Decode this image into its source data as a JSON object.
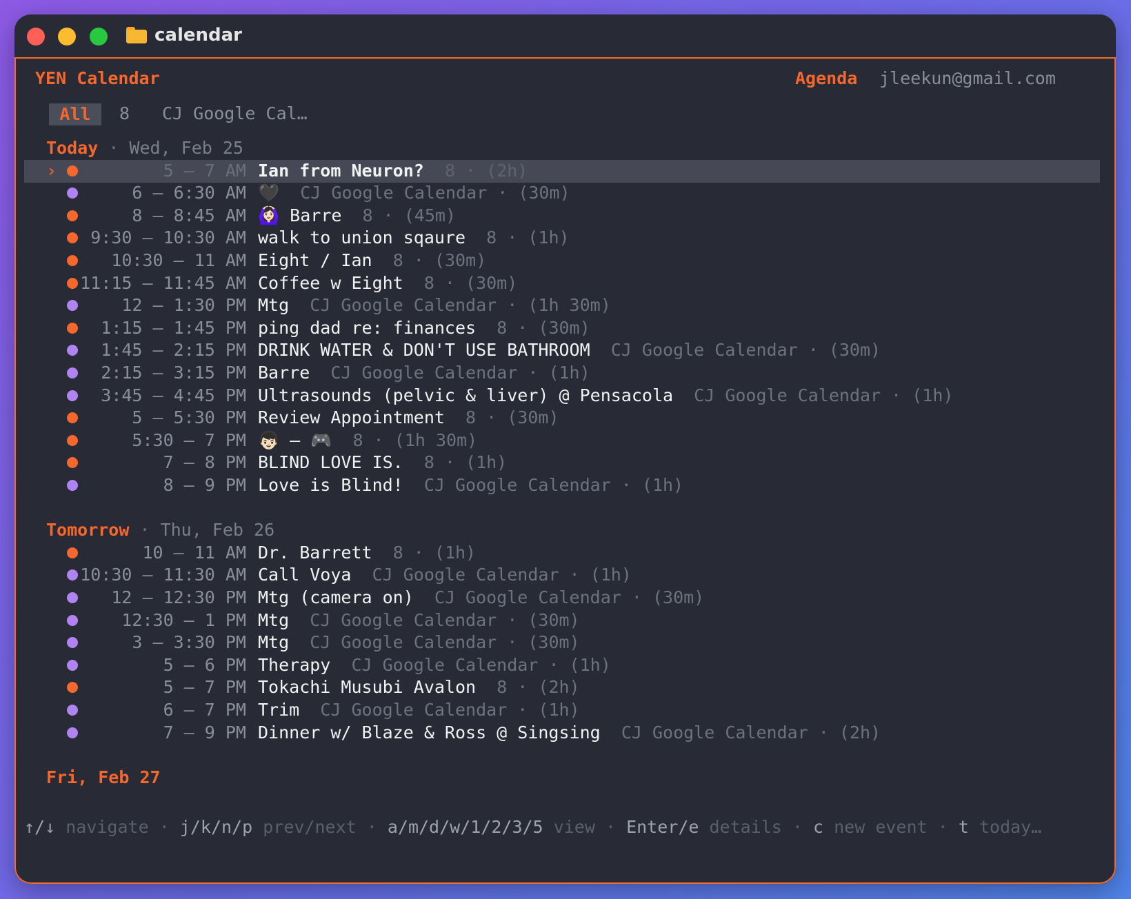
{
  "window": {
    "title": "calendar"
  },
  "header": {
    "app_title": "YEN Calendar",
    "view_label": "Agenda",
    "account": "jleekun@gmail.com"
  },
  "tabs": [
    {
      "label": "All",
      "active": true
    },
    {
      "label": "8",
      "active": false
    },
    {
      "label": "CJ Google Cal…",
      "active": false
    }
  ],
  "colors": {
    "accent": "#f4682d",
    "purple": "#b084f0",
    "background": "#282a36"
  },
  "sections": [
    {
      "label": "Today",
      "sep": "·",
      "date": "Wed, Feb 25",
      "events": [
        {
          "time": "5 – 7 AM",
          "title": "Ian from Neuron?",
          "meta": "8 · (2h)",
          "color": "orange",
          "selected": true
        },
        {
          "time": "6 – 6:30 AM",
          "title": "🖤",
          "meta": "CJ Google Calendar · (30m)",
          "color": "purple"
        },
        {
          "time": "8 – 8:45 AM",
          "title": "🙆🏻‍♀️ Barre",
          "meta": "8 · (45m)",
          "color": "orange"
        },
        {
          "time": "9:30 – 10:30 AM",
          "title": "walk to union sqaure",
          "meta": "8 · (1h)",
          "color": "orange"
        },
        {
          "time": "10:30 – 11 AM",
          "title": "Eight / Ian",
          "meta": "8 · (30m)",
          "color": "orange"
        },
        {
          "time": "11:15 – 11:45 AM",
          "title": "Coffee w Eight",
          "meta": "8 · (30m)",
          "color": "orange"
        },
        {
          "time": "12 – 1:30 PM",
          "title": "Mtg",
          "meta": "CJ Google Calendar · (1h 30m)",
          "color": "purple"
        },
        {
          "time": "1:15 – 1:45 PM",
          "title": "ping dad re: finances",
          "meta": "8 · (30m)",
          "color": "orange"
        },
        {
          "time": "1:45 – 2:15 PM",
          "title": "DRINK WATER & DON'T USE BATHROOM",
          "meta": "CJ Google Calendar · (30m)",
          "color": "purple"
        },
        {
          "time": "2:15 – 3:15 PM",
          "title": "Barre",
          "meta": "CJ Google Calendar · (1h)",
          "color": "purple"
        },
        {
          "time": "3:45 – 4:45 PM",
          "title": "Ultrasounds (pelvic & liver) @ Pensacola",
          "meta": "CJ Google Calendar · (1h)",
          "color": "purple"
        },
        {
          "time": "5 – 5:30 PM",
          "title": "Review Appointment",
          "meta": "8 · (30m)",
          "color": "orange"
        },
        {
          "time": "5:30 – 7 PM",
          "title": "👦🏻 — 🎮",
          "meta": "8 · (1h 30m)",
          "color": "orange"
        },
        {
          "time": "7 – 8 PM",
          "title": "BLIND LOVE IS.",
          "meta": "8 · (1h)",
          "color": "orange"
        },
        {
          "time": "8 – 9 PM",
          "title": "Love is Blind!",
          "meta": "CJ Google Calendar · (1h)",
          "color": "purple"
        }
      ]
    },
    {
      "label": "Tomorrow",
      "sep": "·",
      "date": "Thu, Feb 26",
      "events": [
        {
          "time": "10 – 11 AM",
          "title": "Dr. Barrett",
          "meta": "8 · (1h)",
          "color": "orange"
        },
        {
          "time": "10:30 – 11:30 AM",
          "title": "Call Voya",
          "meta": "CJ Google Calendar · (1h)",
          "color": "purple"
        },
        {
          "time": "12 – 12:30 PM",
          "title": "Mtg (camera on)",
          "meta": "CJ Google Calendar · (30m)",
          "color": "purple"
        },
        {
          "time": "12:30 – 1 PM",
          "title": "Mtg",
          "meta": "CJ Google Calendar · (30m)",
          "color": "purple"
        },
        {
          "time": "3 – 3:30 PM",
          "title": "Mtg",
          "meta": "CJ Google Calendar · (30m)",
          "color": "purple"
        },
        {
          "time": "5 – 6 PM",
          "title": "Therapy",
          "meta": "CJ Google Calendar · (1h)",
          "color": "purple"
        },
        {
          "time": "5 – 7 PM",
          "title": "Tokachi Musubi Avalon",
          "meta": "8 · (2h)",
          "color": "orange"
        },
        {
          "time": "6 – 7 PM",
          "title": "Trim",
          "meta": "CJ Google Calendar · (1h)",
          "color": "purple"
        },
        {
          "time": "7 – 9 PM",
          "title": "Dinner w/ Blaze & Ross @ Singsing",
          "meta": "CJ Google Calendar · (2h)",
          "color": "purple"
        }
      ]
    },
    {
      "label": "Fri, Feb 27",
      "sep": "",
      "date": "",
      "events": []
    }
  ],
  "footer": [
    {
      "key": "↑/↓",
      "desc": "navigate"
    },
    {
      "key": "j/k/n/p",
      "desc": "prev/next"
    },
    {
      "key": "a/m/d/w/1/2/3/5",
      "desc": "view"
    },
    {
      "key": "Enter/e",
      "desc": "details"
    },
    {
      "key": "c",
      "desc": "new event"
    },
    {
      "key": "t",
      "desc": "today…"
    }
  ],
  "footer_sep": "·"
}
